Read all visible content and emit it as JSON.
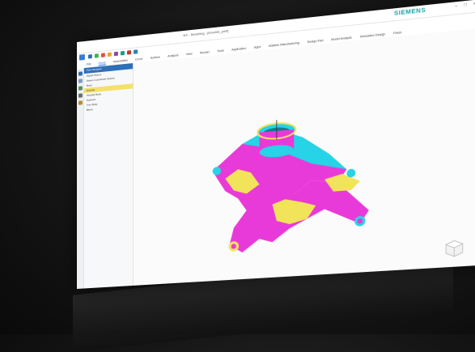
{
  "window": {
    "title": "NX - Modeling - [knuckle_part]",
    "brand": "SIEMENS",
    "controls": [
      "–",
      "□",
      "×"
    ]
  },
  "ribbon": {
    "tabs": [
      "File",
      "Home",
      "Assemblies",
      "Curve",
      "Surface",
      "Analysis",
      "View",
      "Render",
      "Tools",
      "Application",
      "Apps",
      "Additive Manufacturing",
      "Design Part",
      "Model Analysis",
      "Simulation Design",
      "Finish"
    ]
  },
  "navigator": {
    "header": "Part Navigator",
    "items": [
      {
        "label": "Model History",
        "selected": false
      },
      {
        "label": "Datum Coordinate System",
        "selected": false
      },
      {
        "label": "Body",
        "selected": false
      },
      {
        "label": "Extrude",
        "selected": true
      },
      {
        "label": "Simplify Body",
        "selected": false
      },
      {
        "label": "Subtract",
        "selected": false
      },
      {
        "label": "Trim Body",
        "selected": false
      },
      {
        "label": "Blend",
        "selected": false
      }
    ]
  },
  "colors": {
    "accent": "#2f6fb7",
    "brand": "#1aa2a6",
    "model_magenta": "#e83ad8",
    "model_cyan": "#27d3e6",
    "model_yellow": "#f2e45a"
  },
  "icons": [
    "nx-logo-icon",
    "save-icon",
    "undo-icon",
    "redo-icon",
    "settings-icon",
    "view-cube-icon"
  ]
}
